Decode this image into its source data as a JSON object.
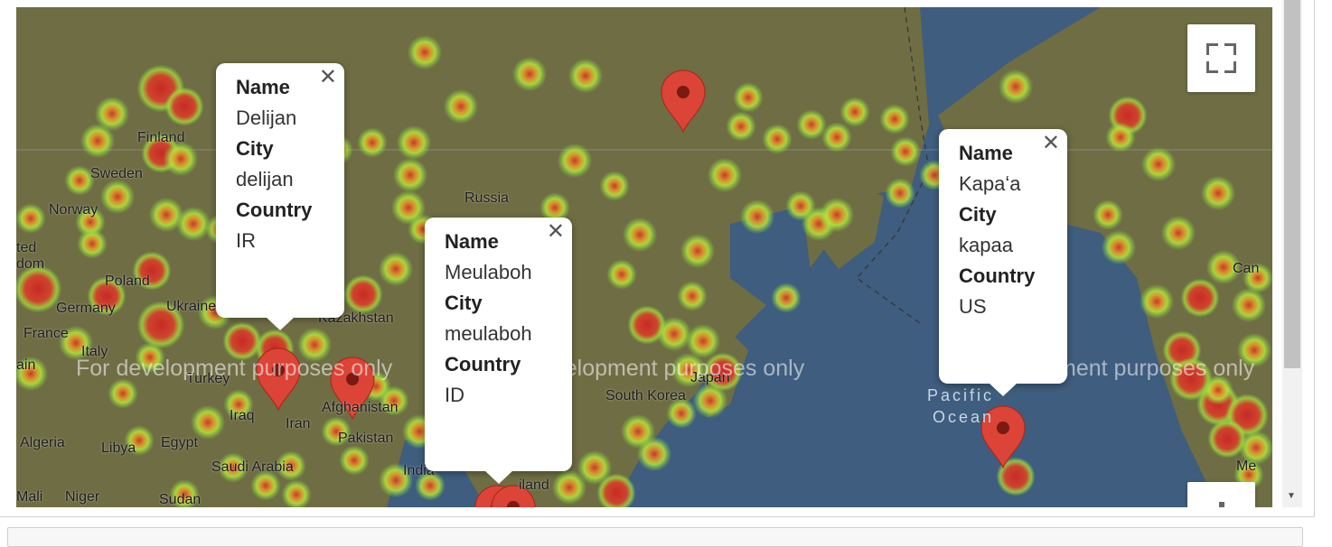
{
  "map": {
    "watermark": "For development purposes only",
    "places": [
      {
        "id": "finland",
        "label": "Finland"
      },
      {
        "id": "sweden",
        "label": "Sweden"
      },
      {
        "id": "norway",
        "label": "Norway"
      },
      {
        "id": "united-kingdom",
        "label": "ted\ndom"
      },
      {
        "id": "poland",
        "label": "Poland"
      },
      {
        "id": "germany",
        "label": "Germany"
      },
      {
        "id": "ukraine",
        "label": "Ukraine"
      },
      {
        "id": "france",
        "label": "France"
      },
      {
        "id": "italy",
        "label": "Italy"
      },
      {
        "id": "spain",
        "label": "ain"
      },
      {
        "id": "turkey",
        "label": "Turkey"
      },
      {
        "id": "russia",
        "label": "Russia"
      },
      {
        "id": "kazakhstan",
        "label": "Kazakhstan"
      },
      {
        "id": "iraq",
        "label": "Iraq"
      },
      {
        "id": "iran",
        "label": "Iran"
      },
      {
        "id": "afghanistan",
        "label": "Afghanistan"
      },
      {
        "id": "pakistan",
        "label": "Pakistan"
      },
      {
        "id": "india",
        "label": "India"
      },
      {
        "id": "thailand",
        "label": "iland"
      },
      {
        "id": "algeria",
        "label": "Algeria"
      },
      {
        "id": "libya",
        "label": "Libya"
      },
      {
        "id": "egypt",
        "label": "Egypt"
      },
      {
        "id": "saudi-arabia",
        "label": "Saudi Arabia"
      },
      {
        "id": "mali",
        "label": "Mali"
      },
      {
        "id": "niger",
        "label": "Niger"
      },
      {
        "id": "sudan",
        "label": "Sudan"
      },
      {
        "id": "south-korea",
        "label": "South Korea"
      },
      {
        "id": "japan",
        "label": "Japan"
      },
      {
        "id": "pacific",
        "label": "Pacific"
      },
      {
        "id": "ocean",
        "label": "Ocean"
      },
      {
        "id": "canada",
        "label": "Can"
      },
      {
        "id": "mexico",
        "label": "Me"
      }
    ]
  },
  "info_windows": [
    {
      "id": "delijan",
      "name_label": "Name",
      "name": "Delijan",
      "city_label": "City",
      "city": "delijan",
      "country_label": "Country",
      "country": "IR"
    },
    {
      "id": "meulaboh",
      "name_label": "Name",
      "name": "Meulaboh",
      "city_label": "City",
      "city": "meulaboh",
      "country_label": "Country",
      "country": "ID"
    },
    {
      "id": "kapaa",
      "name_label": "Name",
      "name": "Kapaʻa",
      "city_label": "City",
      "city": "kapaa",
      "country_label": "Country",
      "country": "US"
    }
  ],
  "controls": {
    "fullscreen_icon": "fullscreen-icon",
    "zoom_icon": "zoom-in-icon",
    "close_icon": "close-icon"
  },
  "colors": {
    "water": "#3f5d7e",
    "land": "#6f6d44",
    "marker": "#db4437",
    "heat_low": "#7cd64a",
    "heat_high": "#d43a2c"
  }
}
